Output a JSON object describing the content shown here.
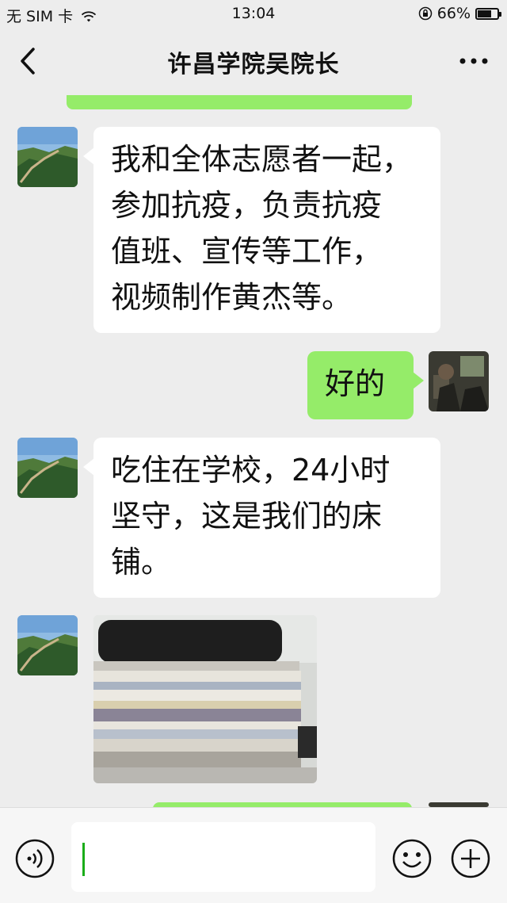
{
  "status_bar": {
    "carrier": "无 SIM 卡",
    "time": "13:04",
    "battery": "66%",
    "battery_level": 0.66
  },
  "header": {
    "title": "许昌学院吴院长"
  },
  "messages": [
    {
      "sender": "other",
      "type": "text",
      "text": "我和全体志愿者一起，\n参加抗疫，负责抗疫\n值班、宣传等工作，\n视频制作黄杰等。"
    },
    {
      "sender": "me",
      "type": "text",
      "text": "好的"
    },
    {
      "sender": "other",
      "type": "text",
      "text": "吃住在学校，24小时\n坚守，这是我们的床\n铺。"
    },
    {
      "sender": "other",
      "type": "image"
    }
  ],
  "input": {
    "placeholder": ""
  },
  "icons": {
    "back": "chevron-left-icon",
    "more": "more-dots-icon",
    "voice": "voice-icon",
    "emoji": "emoji-icon",
    "plus": "plus-icon"
  },
  "colors": {
    "background": "#ededed",
    "sent_bubble": "#95ec69",
    "received_bubble": "#ffffff",
    "caret": "#1aad19"
  }
}
